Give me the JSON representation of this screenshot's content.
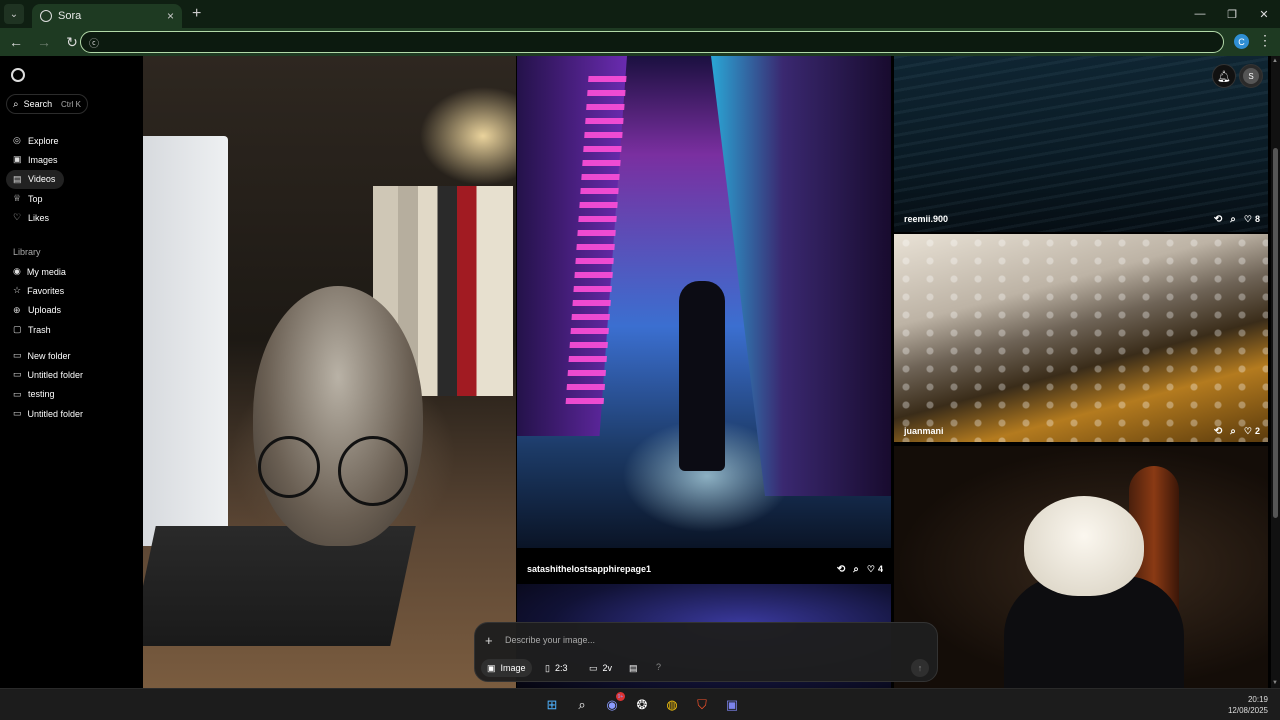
{
  "browser": {
    "tab_title": "Sora",
    "tab_close": "×",
    "new_tab": "+",
    "tab_menu": "⌄",
    "address_value": "",
    "address_icon": "ⓒ",
    "profile_letter": "C",
    "menu": "⋮",
    "back": "←",
    "forward": "→",
    "reload": "↻",
    "minimize": "—",
    "maximize": "❐",
    "close": "✕"
  },
  "sidebar": {
    "search_label": "Search",
    "search_shortcut": "Ctrl K",
    "nav": [
      {
        "label": "Explore",
        "icon": "compass-icon",
        "glyph": "◎"
      },
      {
        "label": "Images",
        "icon": "image-icon",
        "glyph": "▣"
      },
      {
        "label": "Videos",
        "icon": "video-icon",
        "glyph": "▤"
      },
      {
        "label": "Top",
        "icon": "trophy-icon",
        "glyph": "♕"
      },
      {
        "label": "Likes",
        "icon": "heart-icon",
        "glyph": "♡"
      }
    ],
    "library_title": "Library",
    "library": [
      {
        "label": "My media",
        "icon": "media-icon",
        "glyph": "◉"
      },
      {
        "label": "Favorites",
        "icon": "star-icon",
        "glyph": "☆"
      },
      {
        "label": "Uploads",
        "icon": "upload-icon",
        "glyph": "⊕"
      },
      {
        "label": "Trash",
        "icon": "trash-icon",
        "glyph": "▢"
      }
    ],
    "folders": [
      {
        "label": "New folder",
        "glyph": "▭"
      },
      {
        "label": "Untitled folder",
        "glyph": "▭"
      },
      {
        "label": "testing",
        "glyph": "▭"
      },
      {
        "label": "Untitled folder",
        "glyph": "▭"
      }
    ]
  },
  "cards": {
    "middle": {
      "user": "satashithelostsapphirepage1",
      "likes": "4"
    },
    "sea": {
      "user": "reemii.900",
      "likes": "8"
    },
    "bottle": {
      "user": "juanmani",
      "likes": "2"
    }
  },
  "top_right": {
    "avatar_letter": "S"
  },
  "composer": {
    "placeholder": "Describe your image...",
    "type_label": "Image",
    "ratio_label": "2:3",
    "variants_label": "2v",
    "help": "?",
    "plus": "+",
    "send": "↑"
  },
  "taskbar": {
    "time": "20:19",
    "date": "12/08/2025",
    "discord_badge": "9+"
  },
  "colors": {
    "chrome_dark": "#0f1f12",
    "chrome_bar": "#1e3a22",
    "omnibox_border": "#b3d9a9",
    "active_nav": "#222222"
  }
}
